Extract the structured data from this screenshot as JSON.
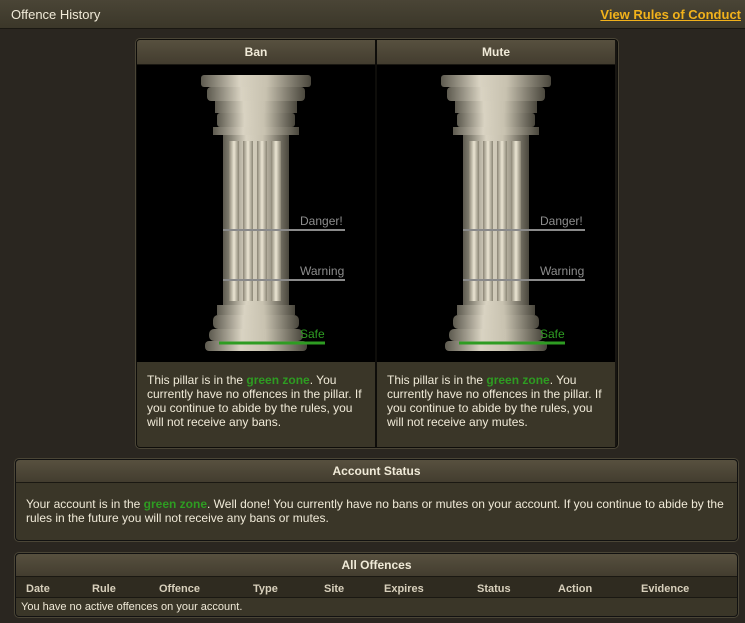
{
  "header": {
    "title": "Offence History",
    "rules_link": "View Rules of Conduct"
  },
  "pillars": {
    "ban": {
      "title": "Ban",
      "levels": {
        "danger": "Danger!",
        "warning": "Warning",
        "safe": "Safe"
      },
      "text_before": "This pillar is in the ",
      "zone": "green zone",
      "text_after": ". You currently have no offences in the pillar. If you continue to abide by the rules, you will not receive any bans."
    },
    "mute": {
      "title": "Mute",
      "levels": {
        "danger": "Danger!",
        "warning": "Warning",
        "safe": "Safe"
      },
      "text_before": "This pillar is in the ",
      "zone": "green zone",
      "text_after": ". You currently have no offences in the pillar. If you continue to abide by the rules, you will not receive any mutes."
    }
  },
  "account_status": {
    "title": "Account Status",
    "text_before": "Your account is in the ",
    "zone": "green zone",
    "text_after": ". Well done! You currently have no bans or mutes on your account. If you continue to abide by the rules in the future you will not receive any bans or mutes."
  },
  "offences": {
    "title": "All Offences",
    "columns": [
      "Date",
      "Rule",
      "Offence",
      "Type",
      "Site",
      "Expires",
      "Status",
      "Action",
      "Evidence"
    ],
    "empty": "You have no active offences on your account."
  },
  "colors": {
    "accent": "#f2b21b",
    "safe": "#2e9c22",
    "danger_line": "#9c9c9c"
  }
}
